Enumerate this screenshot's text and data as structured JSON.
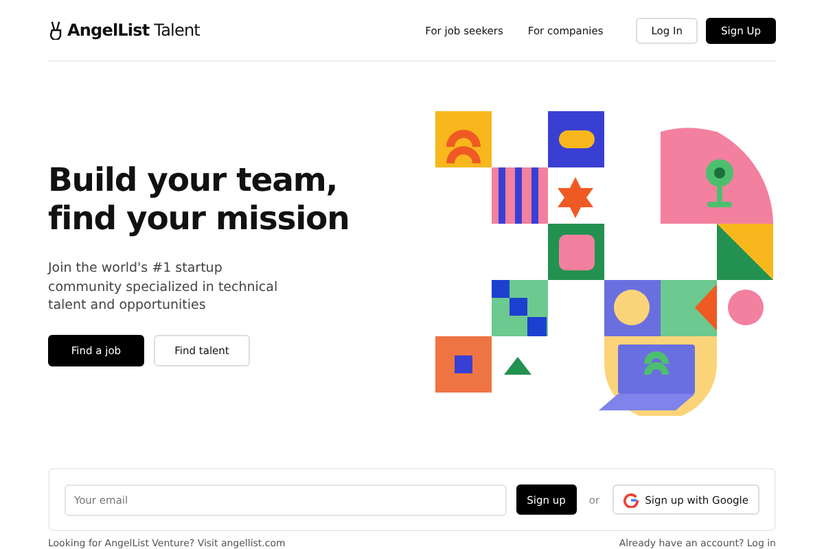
{
  "header": {
    "logo": "AngelList",
    "logo_suffix": "Talent",
    "nav": [
      "For job seekers",
      "For companies"
    ],
    "login": "Log In",
    "signup": "Sign Up"
  },
  "hero": {
    "title_lines": [
      "Build your team,",
      "find your mission"
    ],
    "subtitle": "Join the world's #1 startup community specialized in technical talent and opportunities",
    "primary": "Find a job",
    "secondary": "Find talent"
  },
  "signup_bar": {
    "placeholder": "Your email",
    "submit": "Sign up",
    "or": "or",
    "google": "Sign up with Google"
  },
  "footer": {
    "left": "Looking for AngelList Venture? Visit angellist.com",
    "right": "Already have an account? Log in"
  }
}
